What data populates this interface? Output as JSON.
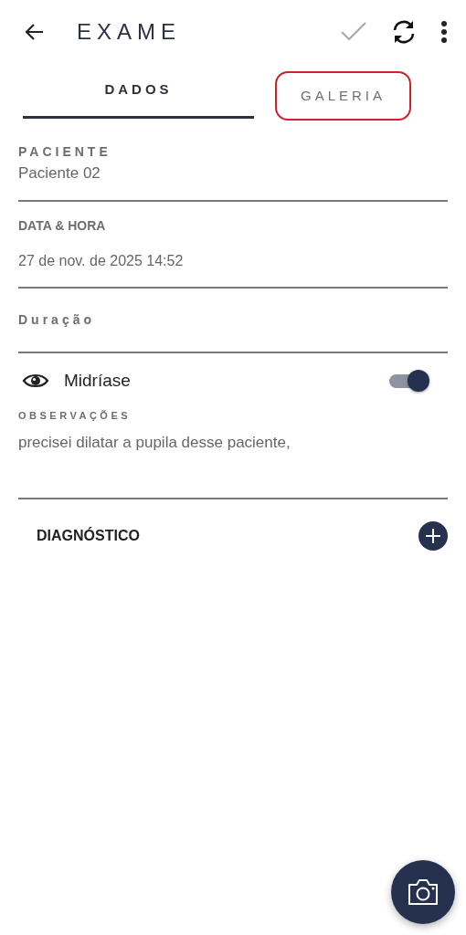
{
  "app_bar": {
    "title": "EXAME",
    "save_enabled": false
  },
  "tabs": [
    {
      "label": "DADOS",
      "selected": true,
      "highlighted": false
    },
    {
      "label": "GALERIA",
      "selected": false,
      "highlighted": true
    }
  ],
  "fields": [
    {
      "kind": "value",
      "label": "PACIENTE",
      "value": "Paciente 02"
    },
    {
      "kind": "input",
      "label": "DATA & HORA",
      "value": "27 de nov. de 2025 14:52"
    },
    {
      "kind": "empty",
      "label": "Duração"
    }
  ],
  "toggle": {
    "label": "Midríase",
    "on": true
  },
  "observations": {
    "label": "OBSERVAÇÕES",
    "value": "precisei dilatar a pupila desse paciente,"
  },
  "diagnosis": {
    "label": "DIAGNÓSTICO"
  }
}
